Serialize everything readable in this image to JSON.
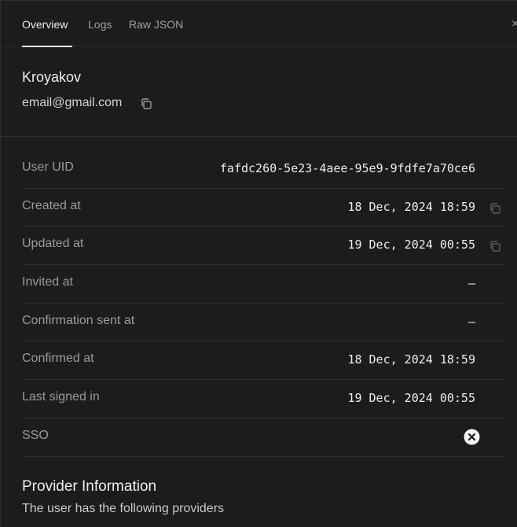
{
  "tabs": [
    {
      "label": "Overview",
      "active": true
    },
    {
      "label": "Logs",
      "active": false
    },
    {
      "label": "Raw JSON",
      "active": false
    }
  ],
  "close_glyph": "×",
  "user": {
    "name": "Kroyakov",
    "email": "email@gmail.com"
  },
  "details": {
    "user_uid": {
      "label": "User UID",
      "value": "fafdc260-5e23-4aee-95e9-9fdfe7a70ce6"
    },
    "created_at": {
      "label": "Created at",
      "value": "18 Dec, 2024 18:59"
    },
    "updated_at": {
      "label": "Updated at",
      "value": "19 Dec, 2024 00:55"
    },
    "invited_at": {
      "label": "Invited at",
      "value": "–"
    },
    "confirmation_sent_at": {
      "label": "Confirmation sent at",
      "value": "–"
    },
    "confirmed_at": {
      "label": "Confirmed at",
      "value": "18 Dec, 2024 18:59"
    },
    "last_signed_in": {
      "label": "Last signed in",
      "value": "19 Dec, 2024 00:55"
    },
    "sso": {
      "label": "SSO",
      "value_icon": "x-circle-icon"
    }
  },
  "provider": {
    "title": "Provider Information",
    "description": "The user has the following providers"
  },
  "icons": {
    "copy": "copy-icon",
    "sso_status": "x-circle-icon",
    "close": "close-icon"
  },
  "colors": {
    "background": "#1c1c1c",
    "border": "#2e2e2e",
    "text_primary": "#ededed",
    "text_muted": "#9a9a9a"
  }
}
